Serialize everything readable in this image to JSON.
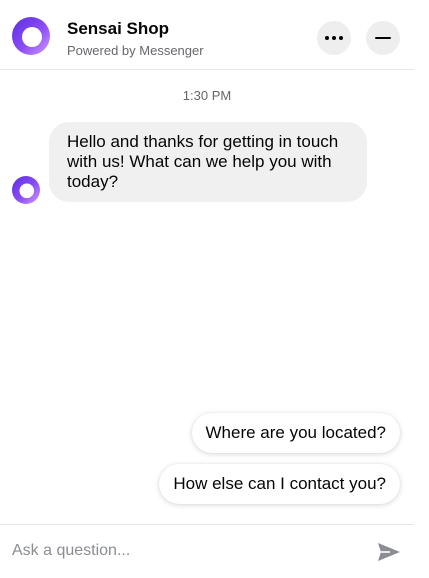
{
  "header": {
    "title": "Sensai Shop",
    "subtitle": "Powered by Messenger",
    "logo_icon": "sensai-ring-icon",
    "more_icon": "more-dots-icon",
    "minimize_icon": "minimize-icon"
  },
  "conversation": {
    "timestamp": "1:30 PM",
    "messages": [
      {
        "sender": "bot",
        "text": "Hello and thanks for getting in touch with us! What can we help you with today?"
      }
    ]
  },
  "quick_replies": [
    {
      "label": "Where are you located?"
    },
    {
      "label": "How else can I contact you?"
    }
  ],
  "composer": {
    "placeholder": "Ask a question...",
    "value": "",
    "send_icon": "send-icon"
  },
  "colors": {
    "brand_gradient_start": "#6a3df0",
    "brand_gradient_end": "#c27bff",
    "bubble_background": "#f0f0f0",
    "secondary_text": "#65676b",
    "send_icon": "#8a8d91"
  }
}
